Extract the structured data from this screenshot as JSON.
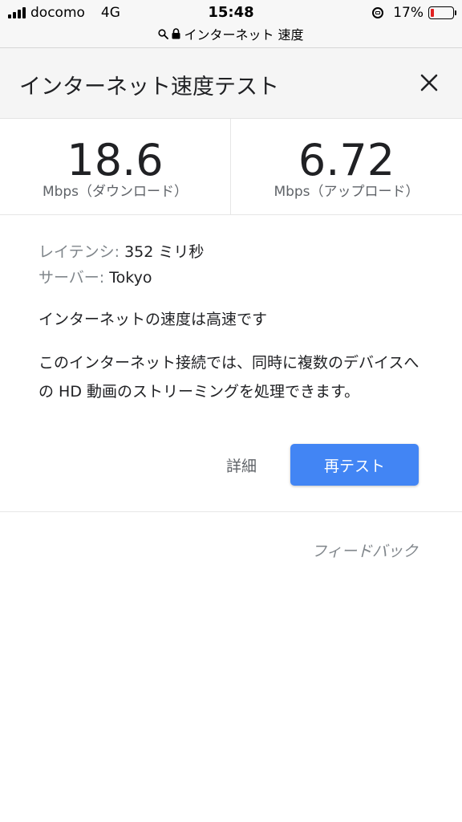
{
  "status_bar": {
    "carrier": "docomo",
    "network": "4G",
    "time": "15:48",
    "battery_percent": "17%",
    "battery_level": 0.17,
    "battery_color": "#e02020"
  },
  "url_bar": {
    "text": "インターネット 速度",
    "search_icon": "search-icon",
    "lock_icon": "lock-icon"
  },
  "header": {
    "title": "インターネット速度テスト",
    "close_icon": "close-icon"
  },
  "speeds": {
    "download": {
      "value": "18.6",
      "label": "Mbps（ダウンロード）"
    },
    "upload": {
      "value": "6.72",
      "label": "Mbps（アップロード）"
    }
  },
  "details": {
    "latency_key": "レイテンシ:",
    "latency_value": "352 ミリ秒",
    "server_key": "サーバー:",
    "server_value": "Tokyo"
  },
  "status_text": "インターネットの速度は高速です",
  "description": "このインターネット接続では、同時に複数のデバイスへの HD 動画のストリーミングを処理できます。",
  "actions": {
    "details_label": "詳細",
    "retest_label": "再テスト",
    "feedback_label": "フィードバック"
  },
  "colors": {
    "accent": "#4285f4"
  }
}
